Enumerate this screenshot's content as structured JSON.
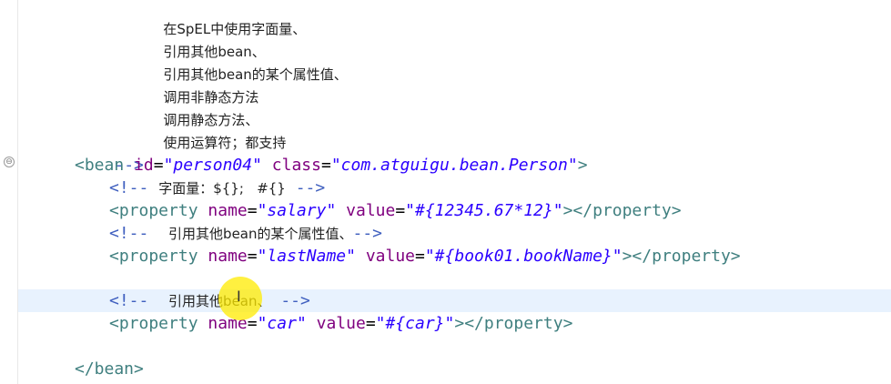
{
  "comment_block": {
    "line1": "在SpEL中使用字面量、",
    "line2": "引用其他bean、",
    "line3": "引用其他bean的某个属性值、",
    "line4": "调用非静态方法",
    "line5": "调用静态方法、",
    "line6": "使用运算符；都支持",
    "close": "-->"
  },
  "bean": {
    "open": "<bean",
    "id_attr": "id",
    "id_value": "\"person04\"",
    "class_attr": "class",
    "class_value": "\"com.atguigu.bean.Person\"",
    "open_end": ">",
    "close_tag": "</bean>"
  },
  "lines": {
    "comment1_start": "<!--",
    "comment1_text": "字面量：${};   #{}",
    "comment1_end": "-->",
    "prop1_open": "<property",
    "prop1_name_attr": "name",
    "prop1_name_val": "\"salary\"",
    "prop1_value_attr": "value",
    "prop1_value_val": "\"#{12345.67*12}\"",
    "prop1_close": "></property>",
    "comment2_start": "<!--",
    "comment2_text": "引用其他bean的某个属性值、",
    "comment2_end": "-->",
    "prop2_open": "<property",
    "prop2_name_attr": "name",
    "prop2_name_val": "\"lastName\"",
    "prop2_value_attr": "value",
    "prop2_value_val": "\"#{book01.bookName}\"",
    "prop2_close": "></property>",
    "comment3_start": "<!--",
    "comment3_text": "引用其他bean、",
    "comment3_end": "-->",
    "prop3_open": "<property",
    "prop3_name_attr": "name",
    "prop3_name_val": "\"car\"",
    "prop3_value_attr": "value",
    "prop3_value_val": "\"#{car}\"",
    "prop3_close": "></property>"
  },
  "fold_icon": "⊖",
  "cursor_glyph": "I"
}
